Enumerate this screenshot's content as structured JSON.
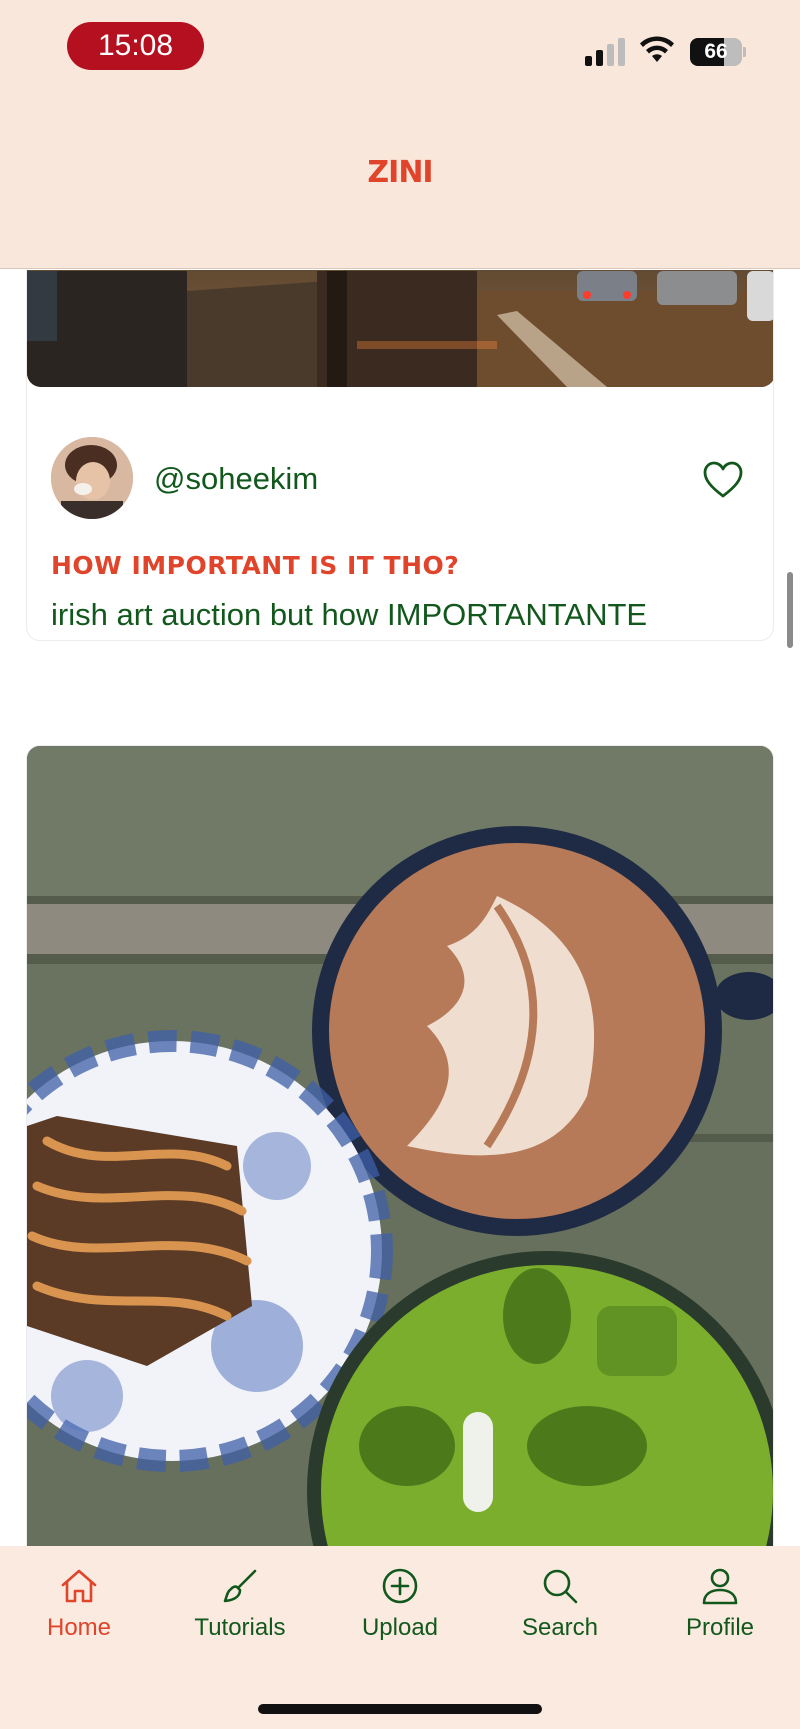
{
  "status_bar": {
    "time": "15:08",
    "battery_level": "66",
    "battery_fraction": 0.66
  },
  "header": {
    "logo_text": "ZINI"
  },
  "feed": {
    "posts": [
      {
        "username": "@soheekim",
        "title": "HOW IMPORTANT IS IT THO?",
        "caption": "irish art auction but how IMPORTANTANTE",
        "liked": false
      }
    ]
  },
  "tab_bar": {
    "active": "home",
    "tabs": [
      {
        "id": "home",
        "label": "Home",
        "icon": "home-icon"
      },
      {
        "id": "tutorials",
        "label": "Tutorials",
        "icon": "brush-icon"
      },
      {
        "id": "upload",
        "label": "Upload",
        "icon": "plus-circle-icon"
      },
      {
        "id": "search",
        "label": "Search",
        "icon": "search-icon"
      },
      {
        "id": "profile",
        "label": "Profile",
        "icon": "person-icon"
      }
    ]
  },
  "colors": {
    "accent": "#e0442a",
    "text_green": "#12581d",
    "header_bg": "#f8e7da",
    "tab_bg": "#fbeae0",
    "time_pill": "#b5101f"
  }
}
